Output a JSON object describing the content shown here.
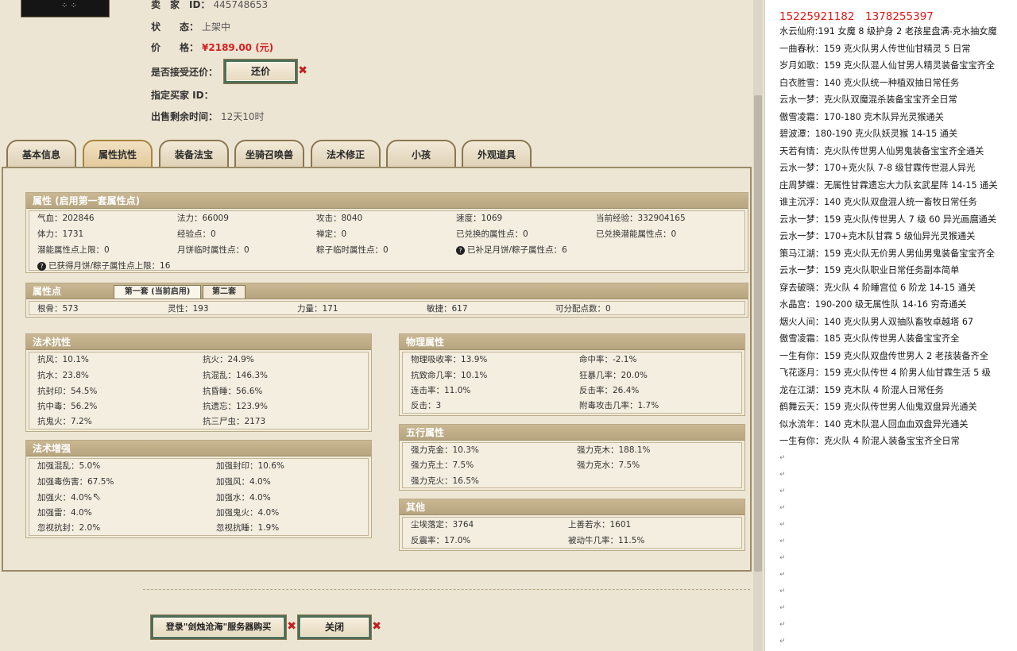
{
  "seller": {
    "id_label": "卖　家　ID：",
    "id_value": "445748653",
    "status_label": "状　　态：",
    "status_value": "上架中",
    "price_label": "价　　格：",
    "price_value": "¥2189.00 (元)",
    "counter_label": "是否接受还价：",
    "counter_button": "还价",
    "buyer_label": "指定买家 ID：",
    "time_label": "出售剩余时间：",
    "time_value": "12天10时"
  },
  "tabs": [
    "基本信息",
    "属性抗性",
    "装备法宝",
    "坐骑召唤兽",
    "法术修正",
    "小孩",
    "外观道具"
  ],
  "active_tab": 1,
  "attributes": {
    "title": "属性 (启用第一套属性点)",
    "rows": [
      [
        "气血：202846",
        "法力：66009",
        "攻击：8040",
        "速度：1069",
        "当前经验：332904165"
      ],
      [
        "体力：1731",
        "经验点：0",
        "禅定：0",
        "已兑换的属性点：0",
        "已兑换潜能属性点：0"
      ],
      [
        "潜能属性点上限：0",
        "月饼临时属性点：0",
        "粽子临时属性点：0",
        "已补足月饼/粽子属性点：6",
        ""
      ],
      [
        "已获得月饼/粽子属性点上限：16",
        "",
        "",
        "",
        ""
      ]
    ]
  },
  "points": {
    "title": "属性点",
    "tab1": "第一套 (当前启用)",
    "tab2": "第二套",
    "values": [
      "根骨：573",
      "灵性：193",
      "力量：171",
      "敏捷：617",
      "可分配点数：0"
    ]
  },
  "resist": {
    "title": "法术抗性",
    "left": [
      "抗风：10.1%",
      "抗水：23.8%",
      "抗封印：54.5%",
      "抗中毒：56.2%",
      "抗鬼火：7.2%"
    ],
    "right": [
      "抗火：24.9%",
      "抗混乱：146.3%",
      "抗昏睡：56.6%",
      "抗遗忘：123.9%",
      "抗三尸虫：2173"
    ]
  },
  "enhance": {
    "title": "法术增强",
    "left": [
      "加强混乱：5.0%",
      "加强毒伤害：67.5%",
      "加强火：4.0%",
      "加强雷：4.0%",
      "忽视抗封：2.0%"
    ],
    "right": [
      "加强封印：10.6%",
      "加强风：4.0%",
      "加强水：4.0%",
      "加强鬼火：4.0%",
      "忽视抗睡：1.9%"
    ]
  },
  "physical": {
    "title": "物理属性",
    "left": [
      "物理吸收率：13.9%",
      "抗致命几率：10.1%",
      "连击率：11.0%",
      "反击：3"
    ],
    "right": [
      "命中率：-2.1%",
      "狂暴几率：20.0%",
      "反击率：26.4%",
      "附毒攻击几率：1.7%"
    ]
  },
  "wuxing": {
    "title": "五行属性",
    "left": [
      "强力克金：10.3%",
      "强力克土：7.5%",
      "强力克火：16.5%"
    ],
    "right": [
      "强力克木：188.1%",
      "强力克水：7.5%",
      ""
    ]
  },
  "other": {
    "title": "其他",
    "left": [
      "尘埃落定：3764",
      "反震率：17.0%"
    ],
    "right": [
      "上善若水：1601",
      "被动牛几率：11.5%"
    ]
  },
  "buttons": {
    "buy": "登录\"剑烛沧海\"服务器购买",
    "close": "关闭"
  },
  "notes": {
    "phones": "15225921182　1378255397",
    "lines": [
      "水云仙府:191 女魔 8 级护身 2 老孩星盘满-克水抽女魔",
      "一曲春秋：159 克火队男人传世仙甘精灵 5 日常",
      "岁月如歌：159 克火队混人仙甘男人精灵装备宝宝齐全",
      "白衣胜雪：140 克火队统一种植双抽日常任务",
      "云水一梦：克火队双魔混杀装备宝宝齐全日常",
      "傲雪凌霜：170-180 克木队异光灵猴通关",
      "碧波潭：180-190 克火队妖灵猴 14-15 通关",
      "天若有情：克火队传世男人仙男鬼装备宝宝齐全通关",
      "云水一梦：170+克火队 7-8 级甘霖传世混人异光",
      "庄周梦蝶：无属性甘霖遗忘大力队玄武星阵 14-15 通关",
      "谁主沉浮：140 克火队双盘混人统一畜牧日常任务",
      "云水一梦：159 克火队传世男人 7 级 60 异光画麿通关",
      "云水一梦：170+克木队甘霖 5 级仙异光灵猴通关",
      "策马江湖：159 克火队无价男人男仙男鬼装备宝宝齐全",
      "云水一梦：159 克火队职业日常任务副本简单",
      "穿去破晓：克火队 4 阶睡宫位 6 阶龙 14-15 通关",
      "水晶宫：190-200 级无属性队 14-16 穷奇通关",
      "烟火人间：140 克火队男人双抽队畜牧卓越塔 67",
      "傲雪凌霜：185 克火队传世男人装备宝宝齐全",
      "一生有你：159 克火队双盘传世男人 2 老孩装备齐全",
      "飞花逐月：159 克火队传世 4 阶男人仙甘霖生活 5 级",
      "龙在江湖：159 克木队 4 阶混人日常任务",
      "鹤舞云天：159 克火队传世男人仙鬼双盘异光通关",
      "似水流年：140 克木队混人回血血双盘异光通关",
      "一生有你：克火队 4 阶混人装备宝宝齐全日常"
    ]
  }
}
